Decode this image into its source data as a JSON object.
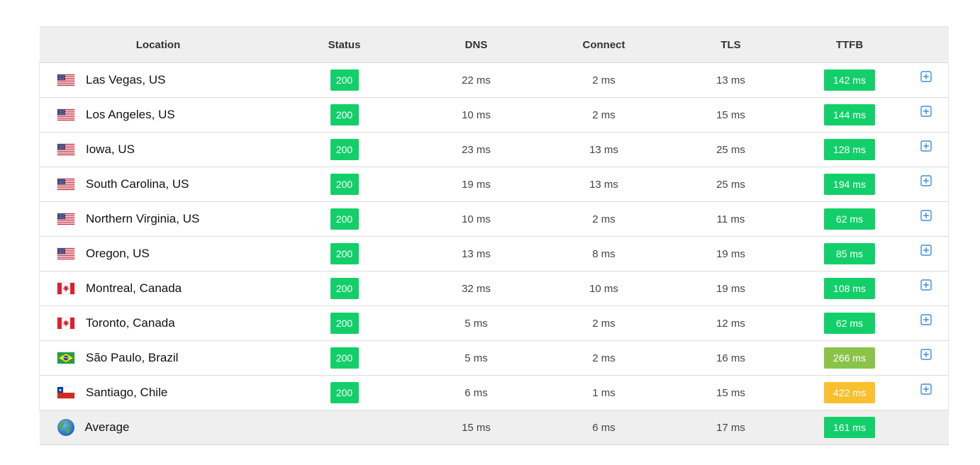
{
  "columns": [
    "Location",
    "Status",
    "DNS",
    "Connect",
    "TLS",
    "TTFB"
  ],
  "colors": {
    "status_ok": "#13cf6a",
    "ttfb_fast": "#13cf6a",
    "ttfb_medium": "#8bc34a",
    "ttfb_slow": "#fbc02d",
    "expand_icon": "#3d8fd8"
  },
  "rows": [
    {
      "flag": "us-flag-icon",
      "location": "Las Vegas, US",
      "status": "200",
      "dns": "22 ms",
      "connect": "2 ms",
      "tls": "13 ms",
      "ttfb": "142 ms",
      "ttfb_color": "#13cf6a"
    },
    {
      "flag": "us-flag-icon",
      "location": "Los Angeles, US",
      "status": "200",
      "dns": "10 ms",
      "connect": "2 ms",
      "tls": "15 ms",
      "ttfb": "144 ms",
      "ttfb_color": "#13cf6a"
    },
    {
      "flag": "us-flag-icon",
      "location": "Iowa, US",
      "status": "200",
      "dns": "23 ms",
      "connect": "13 ms",
      "tls": "25 ms",
      "ttfb": "128 ms",
      "ttfb_color": "#13cf6a"
    },
    {
      "flag": "us-flag-icon",
      "location": "South Carolina, US",
      "status": "200",
      "dns": "19 ms",
      "connect": "13 ms",
      "tls": "25 ms",
      "ttfb": "194 ms",
      "ttfb_color": "#13cf6a"
    },
    {
      "flag": "us-flag-icon",
      "location": "Northern Virginia, US",
      "status": "200",
      "dns": "10 ms",
      "connect": "2 ms",
      "tls": "11 ms",
      "ttfb": "62 ms",
      "ttfb_color": "#13cf6a"
    },
    {
      "flag": "us-flag-icon",
      "location": "Oregon, US",
      "status": "200",
      "dns": "13 ms",
      "connect": "8 ms",
      "tls": "19 ms",
      "ttfb": "85 ms",
      "ttfb_color": "#13cf6a"
    },
    {
      "flag": "canada-flag-icon",
      "location": "Montreal, Canada",
      "status": "200",
      "dns": "32 ms",
      "connect": "10 ms",
      "tls": "19 ms",
      "ttfb": "108 ms",
      "ttfb_color": "#13cf6a"
    },
    {
      "flag": "canada-flag-icon",
      "location": "Toronto, Canada",
      "status": "200",
      "dns": "5 ms",
      "connect": "2 ms",
      "tls": "12 ms",
      "ttfb": "62 ms",
      "ttfb_color": "#13cf6a"
    },
    {
      "flag": "brazil-flag-icon",
      "location": "São Paulo, Brazil",
      "status": "200",
      "dns": "5 ms",
      "connect": "2 ms",
      "tls": "16 ms",
      "ttfb": "266 ms",
      "ttfb_color": "#8bc34a"
    },
    {
      "flag": "chile-flag-icon",
      "location": "Santiago, Chile",
      "status": "200",
      "dns": "6 ms",
      "connect": "1 ms",
      "tls": "15 ms",
      "ttfb": "422 ms",
      "ttfb_color": "#fbc02d"
    }
  ],
  "average": {
    "icon": "globe-icon",
    "location": "Average",
    "dns": "15 ms",
    "connect": "6 ms",
    "tls": "17 ms",
    "ttfb": "161 ms",
    "ttfb_color": "#13cf6a"
  }
}
